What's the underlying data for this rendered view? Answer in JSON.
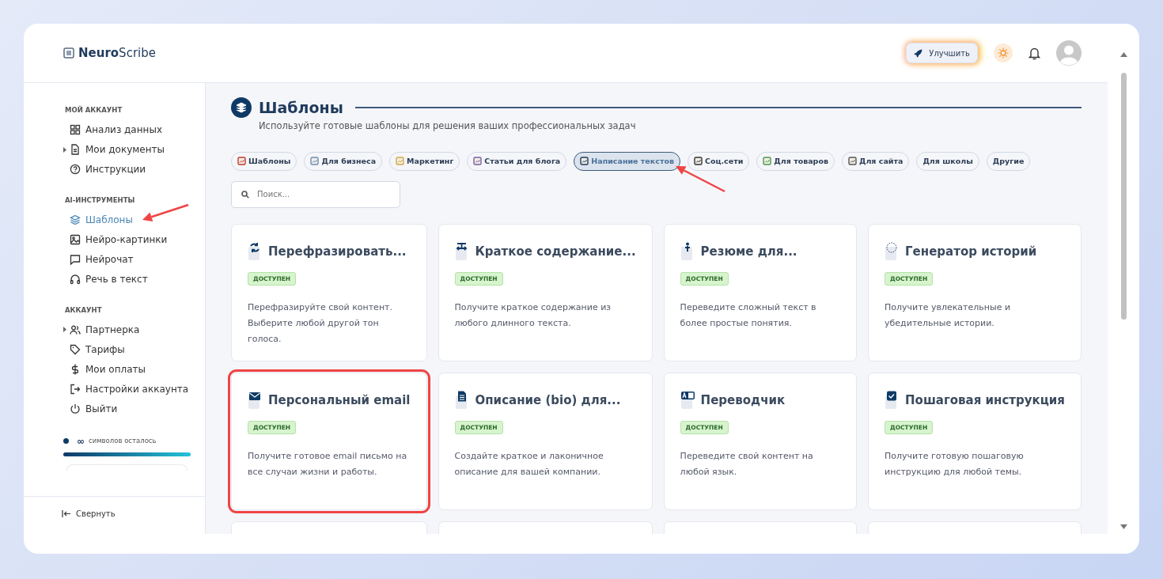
{
  "logo": {
    "bold": "Neuro",
    "light": "Scribe"
  },
  "header": {
    "upgrade_button": "Улучшить"
  },
  "sidebar": {
    "sections": [
      {
        "title": "МОЙ АККАУНТ",
        "items": [
          {
            "label": "Анализ данных",
            "expandable": false,
            "selected": false,
            "marked": false
          },
          {
            "label": "Мои документы",
            "expandable": true,
            "selected": false,
            "marked": false
          },
          {
            "label": "Инструкции",
            "expandable": false,
            "selected": false,
            "marked": false
          }
        ]
      },
      {
        "title": "AI-ИНСТРУМЕНТЫ",
        "items": [
          {
            "label": "Шаблоны",
            "expandable": false,
            "selected": true,
            "marked": true
          },
          {
            "label": "Нейро-картинки",
            "expandable": false,
            "selected": false,
            "marked": false
          },
          {
            "label": "Нейрочат",
            "expandable": false,
            "selected": false,
            "marked": false
          },
          {
            "label": "Речь в текст",
            "expandable": false,
            "selected": false,
            "marked": false
          }
        ]
      },
      {
        "title": "АККАУНТ",
        "items": [
          {
            "label": "Партнерка",
            "expandable": true,
            "selected": false,
            "marked": false
          },
          {
            "label": "Тарифы",
            "expandable": false,
            "selected": false,
            "marked": false
          },
          {
            "label": "Мои оплаты",
            "expandable": false,
            "selected": false,
            "marked": false
          },
          {
            "label": "Настройки аккаунта",
            "expandable": false,
            "selected": false,
            "marked": false
          },
          {
            "label": "Выйти",
            "expandable": false,
            "selected": false,
            "marked": false
          }
        ]
      }
    ],
    "credits": {
      "amount": "∞",
      "label": "символов осталось",
      "level": 1
    },
    "collapse": "Свернуть"
  },
  "page": {
    "title": "Шаблоны",
    "subtitle": "Используйте готовые шаблоны для решения ваших профессиональных задач"
  },
  "filters": [
    {
      "label": "Шаблоны",
      "icon": true,
      "selected": false,
      "marked": false
    },
    {
      "label": "Для бизнеса",
      "icon": true,
      "selected": false,
      "marked": false
    },
    {
      "label": "Маркетинг",
      "icon": true,
      "selected": false,
      "marked": false
    },
    {
      "label": "Статьи для блога",
      "icon": true,
      "selected": false,
      "marked": false
    },
    {
      "label": "Написание текстов",
      "icon": true,
      "selected": true,
      "marked": true
    },
    {
      "label": "Соц.сети",
      "icon": true,
      "selected": false,
      "marked": false
    },
    {
      "label": "Для товаров",
      "icon": true,
      "selected": false,
      "marked": false
    },
    {
      "label": "Для сайта",
      "icon": true,
      "selected": false,
      "marked": false
    },
    {
      "label": "Для школы",
      "icon": false,
      "selected": false,
      "marked": false
    },
    {
      "label": "Другие",
      "icon": false,
      "selected": false,
      "marked": false
    }
  ],
  "search": {
    "placeholder": "Поиск..."
  },
  "cards": [
    {
      "kind": "full",
      "title": "Перефразировать...",
      "badge": "ДОСТУПЕН",
      "description": "Перефразируйте свой контент. Выберите любой другой тон голоса.",
      "marked": false
    },
    {
      "kind": "full",
      "title": "Краткое содержание...",
      "badge": "ДОСТУПЕН",
      "description": "Получите краткое содержание из любого длинного текста.",
      "marked": false
    },
    {
      "kind": "full",
      "title": "Резюме для...",
      "badge": "ДОСТУПЕН",
      "description": "Переведите сложный текст в более простые понятия.",
      "marked": false
    },
    {
      "kind": "full",
      "title": "Генератор историй",
      "badge": "ДОСТУПЕН",
      "description": "Получите увлекательные и убедительные истории.",
      "marked": false
    },
    {
      "kind": "full",
      "title": "Персональный email",
      "badge": "ДОСТУПЕН",
      "description": "Получите готовое email письмо на все случаи жизни и работы.",
      "marked": true
    },
    {
      "kind": "full",
      "title": "Описание (bio) для...",
      "badge": "ДОСТУПЕН",
      "description": "Создайте краткое и лаконичное описание для вашей компании.",
      "marked": false
    },
    {
      "kind": "full",
      "title": "Переводчик",
      "badge": "ДОСТУПЕН",
      "description": "Переведите свой контент на любой язык.",
      "marked": false
    },
    {
      "kind": "full",
      "title": "Пошаговая инструкция",
      "badge": "ДОСТУПЕН",
      "description": "Получите готовую пошаговую инструкцию для любой темы.",
      "marked": false
    },
    {
      "kind": "clipped",
      "marked": false
    },
    {
      "kind": "clipped",
      "marked": false
    },
    {
      "kind": "clipped",
      "marked": false
    },
    {
      "kind": "clipped",
      "marked": false
    }
  ]
}
